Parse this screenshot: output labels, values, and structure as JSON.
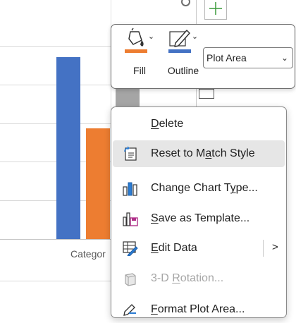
{
  "chart": {
    "category_label": "Categor",
    "series_colors": [
      "#4472C4",
      "#ED7D31",
      "#A5A5A5"
    ]
  },
  "chart_data": {
    "type": "bar",
    "categories": [
      "Categor"
    ],
    "series": [
      {
        "values": [
          4.6
        ]
      },
      {
        "values": [
          2.8
        ]
      },
      {
        "values": [
          4.1
        ]
      }
    ],
    "ylim": [
      0,
      5.5
    ],
    "grid": true
  },
  "mini_toolbar": {
    "fill_label": "Fill",
    "outline_label": "Outline",
    "fill_color": "#ED7D31",
    "outline_color": "#4472C4",
    "fill_icon": "paint-bucket-icon",
    "outline_icon": "pencil-icon",
    "element_select_value": "Plot Area"
  },
  "context_menu": {
    "items": [
      {
        "pre": "",
        "key": "D",
        "post": "elete",
        "icon": "none",
        "disabled": false
      },
      {
        "pre": "Reset to M",
        "key": "a",
        "post": "tch Style",
        "icon": "reset-style-icon",
        "disabled": false
      },
      {
        "pre": "Change Chart T",
        "key": "y",
        "post": "pe...",
        "icon": "change-chart-type-icon",
        "disabled": false
      },
      {
        "pre": "",
        "key": "S",
        "post": "ave as Template...",
        "icon": "save-template-icon",
        "disabled": false
      },
      {
        "pre": "",
        "key": "E",
        "post": "dit Data",
        "icon": "edit-data-icon",
        "disabled": false
      },
      {
        "pre": "3-D ",
        "key": "R",
        "post": "otation...",
        "icon": "3d-rotation-icon",
        "disabled": true
      },
      {
        "pre": "",
        "key": "F",
        "post": "ormat Plot Area...",
        "icon": "format-plot-area-icon",
        "disabled": false
      }
    ],
    "submenu_arrow": ">"
  }
}
